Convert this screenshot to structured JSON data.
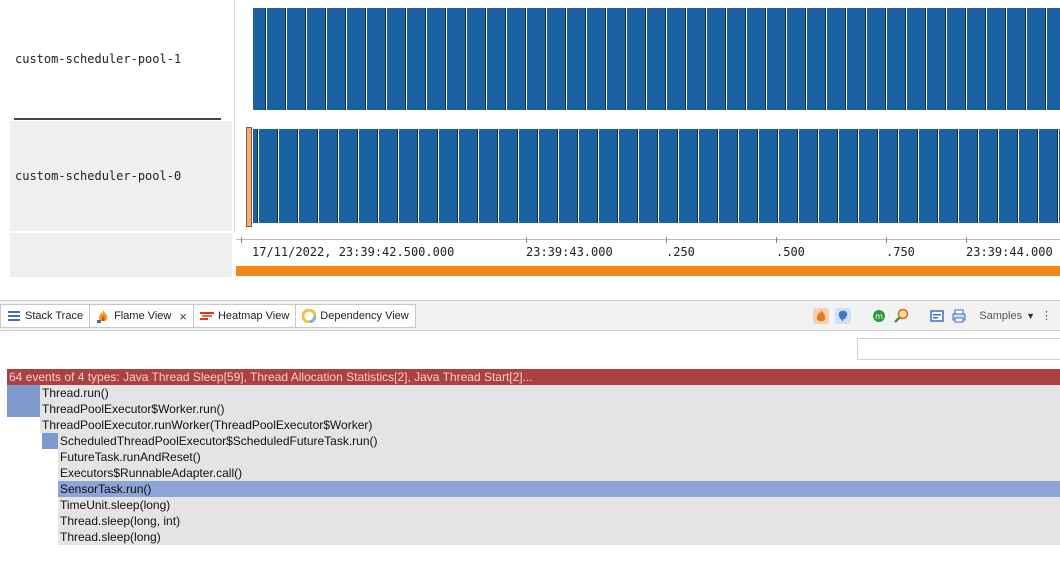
{
  "threads": [
    {
      "name": "custom-scheduler-pool-1"
    },
    {
      "name": "custom-scheduler-pool-0"
    }
  ],
  "axis": {
    "labels": [
      "17/11/2022, 23:39:42.500.000",
      "23:39:43.000",
      ".250",
      ".500",
      ".750",
      "23:39:44.000"
    ]
  },
  "tabs": [
    {
      "label": "Stack Trace",
      "icon": "stack-trace-icon"
    },
    {
      "label": "Flame View",
      "icon": "flame-icon",
      "closable": true
    },
    {
      "label": "Heatmap View",
      "icon": "heatmap-icon"
    },
    {
      "label": "Dependency View",
      "icon": "dependency-icon"
    }
  ],
  "toolbar": {
    "samples_label": "Samples"
  },
  "flame": {
    "root": "64 events of 4 types: Java Thread Sleep[59], Thread Allocation Statistics[2], Java Thread Start[2]...",
    "frames": [
      "Thread.run()",
      "ThreadPoolExecutor$Worker.run()",
      "ThreadPoolExecutor.runWorker(ThreadPoolExecutor$Worker)",
      "ScheduledThreadPoolExecutor$ScheduledFutureTask.run()",
      "FutureTask.runAndReset()",
      "Executors$RunnableAdapter.call()",
      "SensorTask.run()",
      "TimeUnit.sleep(long)",
      "Thread.sleep(long, int)",
      "Thread.sleep(long)"
    ]
  },
  "colors": {
    "lane_bar": "#1b62a5",
    "range_bar": "#ef8a1a",
    "flame_root": "#ad4040",
    "flame_blue": "#7e99cd",
    "flame_grey": "#e4e4e4"
  }
}
